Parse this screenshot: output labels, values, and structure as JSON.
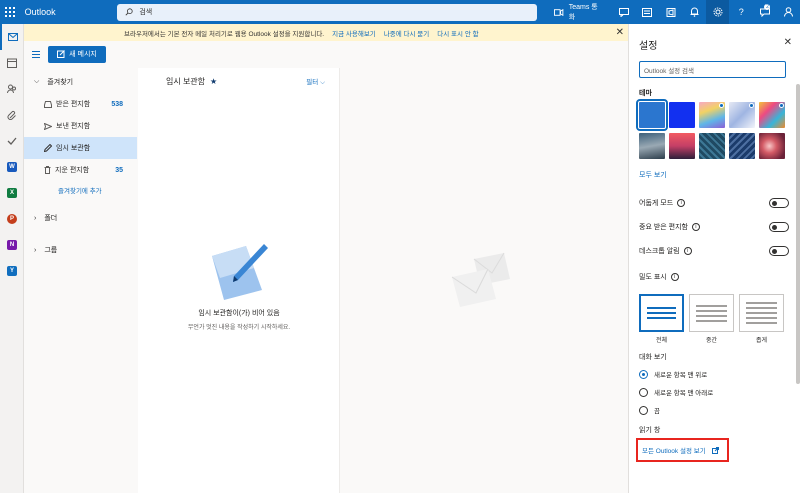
{
  "app": {
    "name": "Outlook"
  },
  "search": {
    "placeholder": "검색"
  },
  "topbar": {
    "teams_label": "Teams 통화",
    "notification_count": "2"
  },
  "infobar": {
    "message": "브라우저에서는 기본 전자 메일 처리기로 웹용 Outlook 설정을 지원합니다.",
    "link_try": "지금 사용해보기",
    "link_later": "나중에 다시 묻기",
    "link_never": "다시 표시 안 함"
  },
  "nav": {
    "new_message": "새 메시지",
    "favorites": "즐겨찾기",
    "items": [
      {
        "label": "받은 편지함",
        "count": "538"
      },
      {
        "label": "보낸 편지함",
        "count": ""
      },
      {
        "label": "임시 보관함",
        "count": ""
      },
      {
        "label": "지운 편지함",
        "count": "35"
      }
    ],
    "add_favorite": "즐겨찾기에 추가",
    "folders": "폴더",
    "groups": "그룹"
  },
  "list": {
    "title": "임시 보관함",
    "filter": "필터",
    "empty_title": "임시 보관함이(가) 비어 있음",
    "empty_sub": "무언가 멋진 내용을 작성하기 시작하세요."
  },
  "settings": {
    "title": "설정",
    "search_placeholder": "Outlook 설정 검색",
    "theme_label": "테마",
    "see_all": "모두 보기",
    "dark_mode": "어둡게 모드",
    "focused_inbox": "중요 받은 편지함",
    "desktop_notifications": "데스크톱 알림",
    "density_label": "밀도 표시",
    "density_options": [
      "전체",
      "중간",
      "좁게"
    ],
    "conversation_label": "대화 보기",
    "conversation_options": [
      "새로운 항목 맨 위로",
      "새로운 항목 맨 아래로",
      "끔"
    ],
    "reading_pane": "읽기 창",
    "all_settings": "모든 Outlook 설정 보기"
  }
}
